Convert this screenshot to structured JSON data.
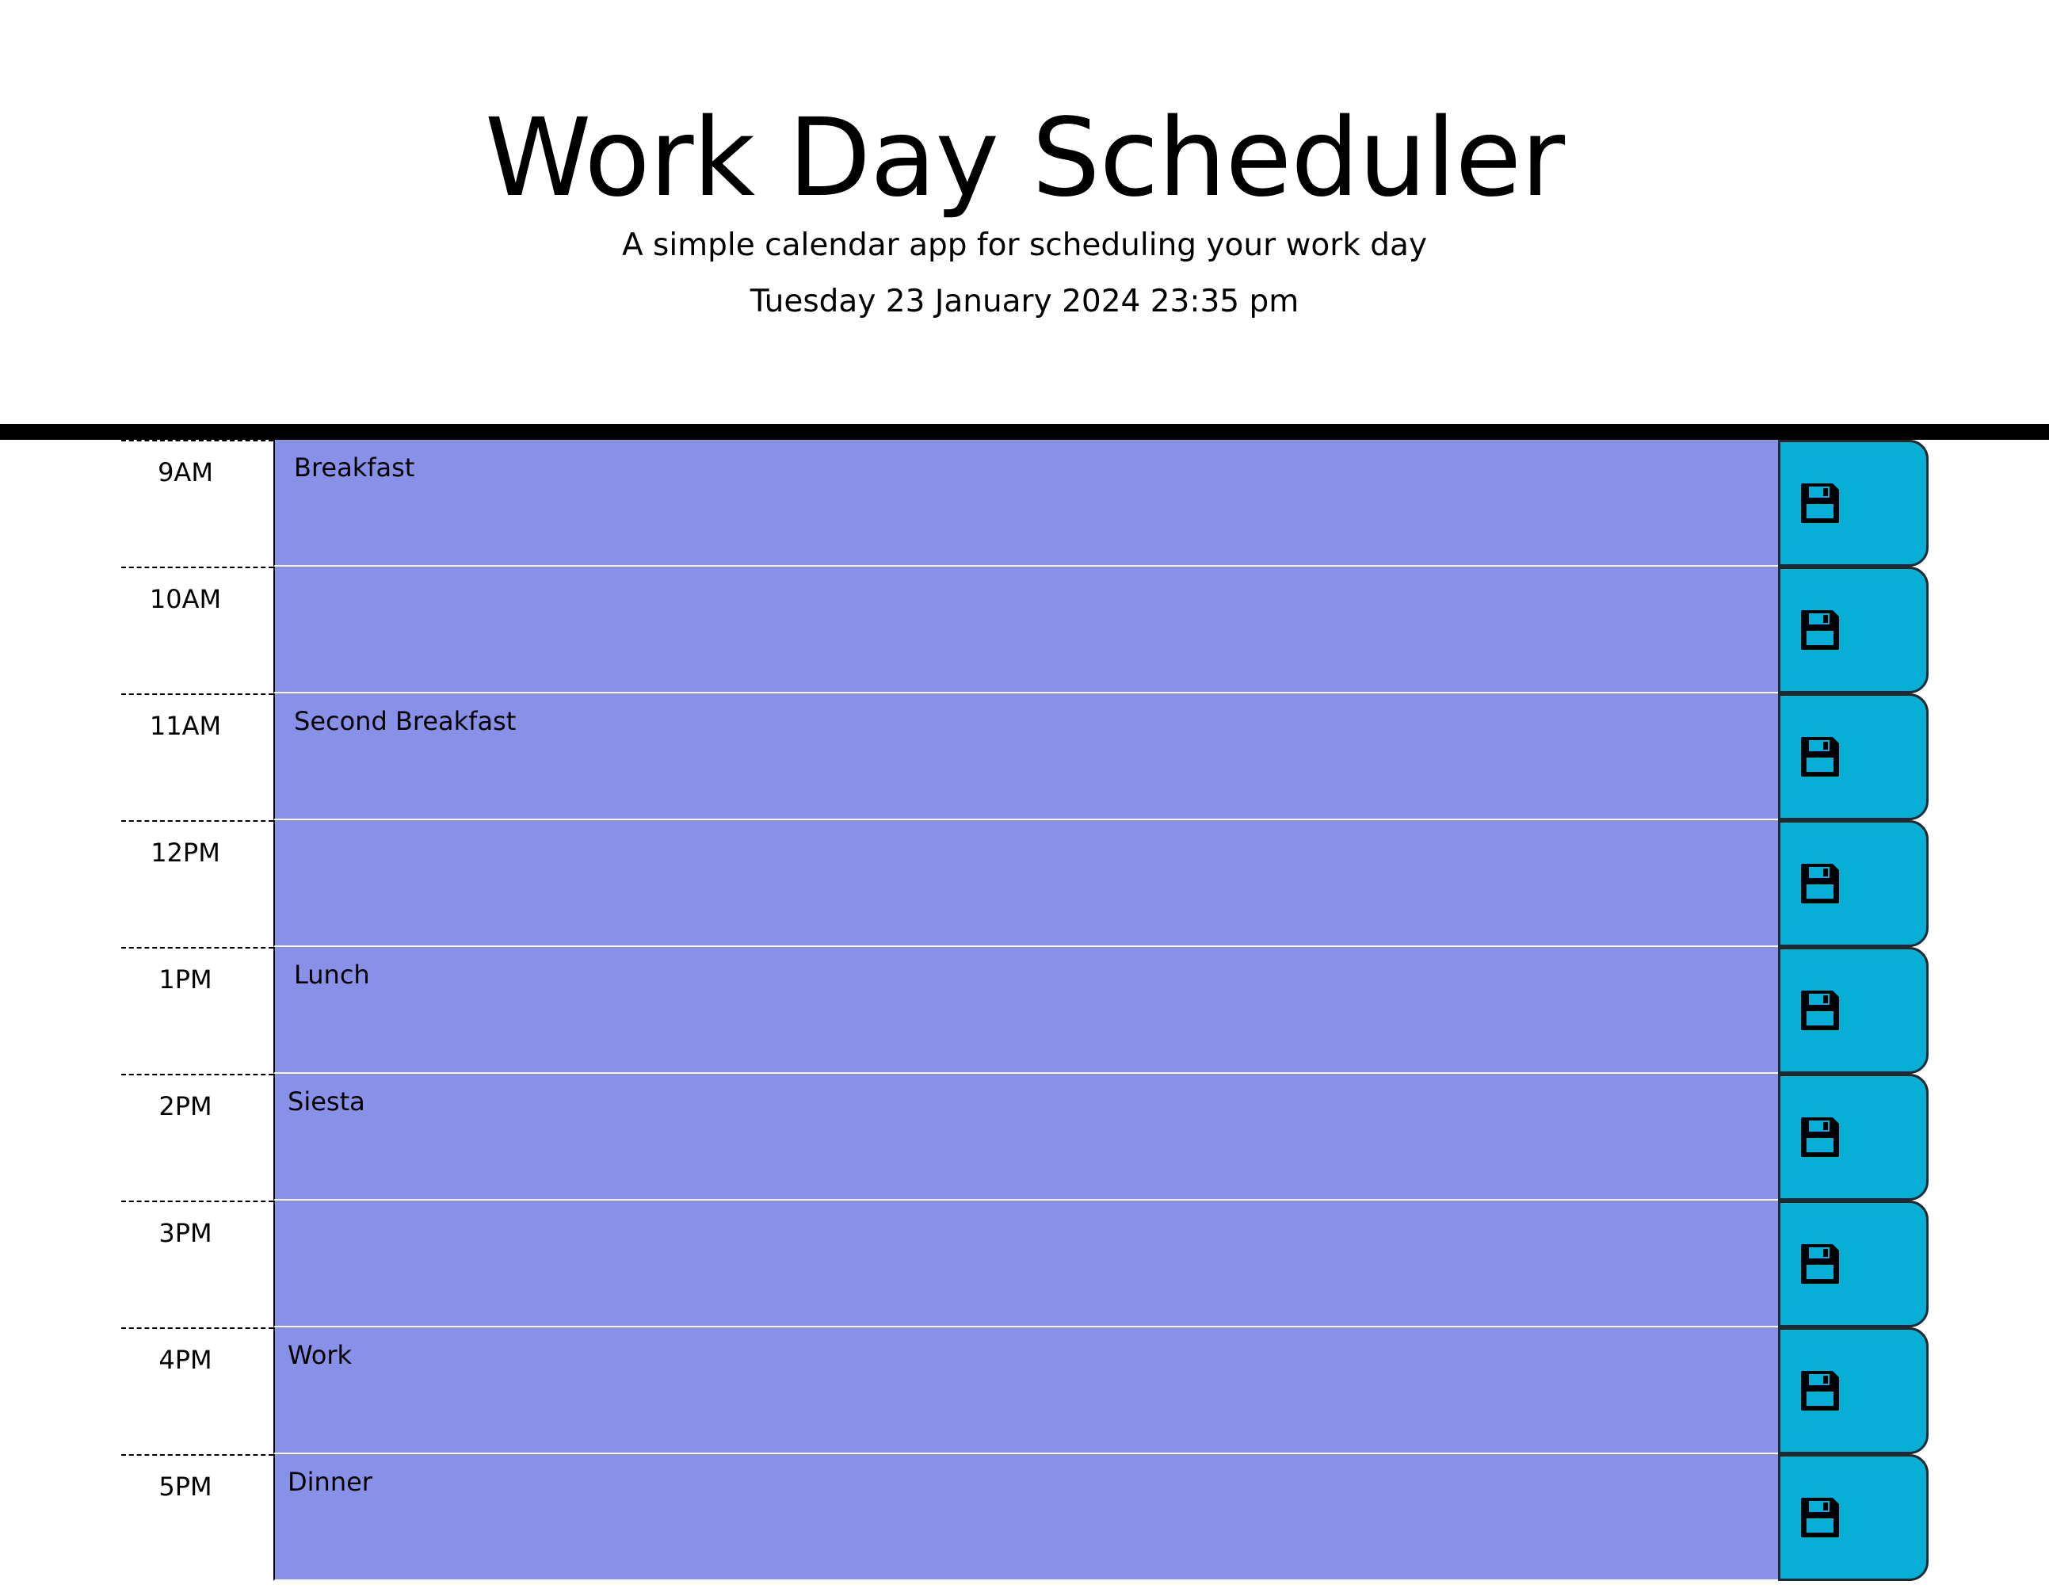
{
  "header": {
    "title": "Work Day Scheduler",
    "subtitle": "A simple calendar app for scheduling your work day",
    "current_datetime": "Tuesday 23 January 2024 23:35 pm"
  },
  "colors": {
    "description_bg": "#8891e8",
    "save_button_bg": "#07afd6",
    "header_border": "#000000"
  },
  "rows": [
    {
      "hour": "9AM",
      "text": "Breakfast",
      "save_icon": "floppy-disk-icon"
    },
    {
      "hour": "10AM",
      "text": "",
      "save_icon": "floppy-disk-icon"
    },
    {
      "hour": "11AM",
      "text": "Second Breakfast",
      "save_icon": "floppy-disk-icon"
    },
    {
      "hour": "12PM",
      "text": "",
      "save_icon": "floppy-disk-icon"
    },
    {
      "hour": "1PM",
      "text": "Lunch",
      "save_icon": "floppy-disk-icon"
    },
    {
      "hour": "2PM",
      "text": "Siesta",
      "save_icon": "floppy-disk-icon"
    },
    {
      "hour": "3PM",
      "text": "",
      "save_icon": "floppy-disk-icon"
    },
    {
      "hour": "4PM",
      "text": "Work",
      "save_icon": "floppy-disk-icon"
    },
    {
      "hour": "5PM",
      "text": "Dinner",
      "save_icon": "floppy-disk-icon"
    }
  ]
}
